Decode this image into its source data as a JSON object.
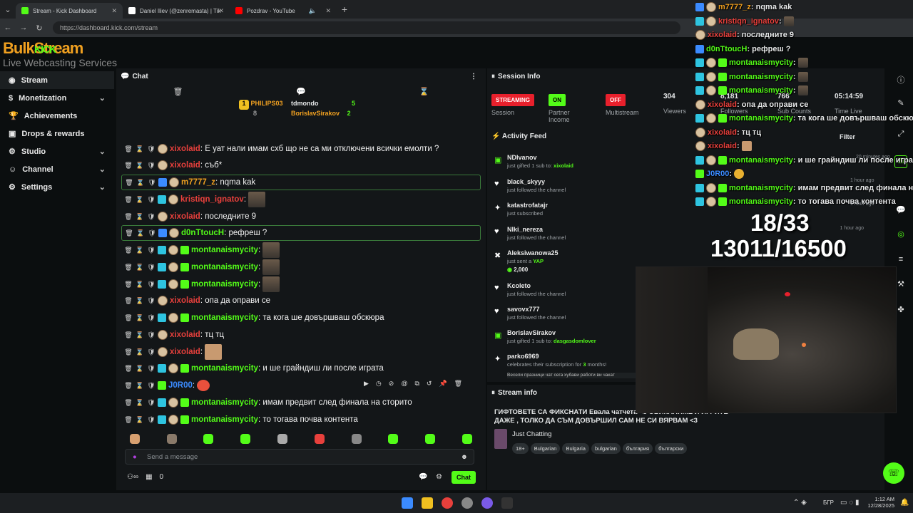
{
  "browser": {
    "tabs": [
      {
        "label": "Stream - Kick Dashboard",
        "color": "#53fc18"
      },
      {
        "label": "Daniel Iliev (@zenremasta) | Tik",
        "color": "#ffffff"
      },
      {
        "label": "Pozdrav - YouTube",
        "color": "#ff0000"
      }
    ],
    "url": "https://dashboard.kick.com/stream"
  },
  "logo": {
    "title": "BulkStream",
    "badge": "KICK",
    "subtitle": "Live Webcasting Services"
  },
  "sidebar": {
    "items": [
      {
        "label": "Stream",
        "icon": "radio-icon"
      },
      {
        "label": "Monetization",
        "icon": "money-icon"
      },
      {
        "label": "Achievements",
        "icon": "trophy-icon"
      },
      {
        "label": "Drops & rewards",
        "icon": "gift-icon"
      },
      {
        "label": "Studio",
        "icon": "gear-icon"
      },
      {
        "label": "Channel",
        "icon": "person-icon"
      },
      {
        "label": "Settings",
        "icon": "gear-icon"
      }
    ]
  },
  "chat": {
    "title": "Chat",
    "leaders": {
      "first": {
        "name": "PHILIPS03",
        "count": "8"
      },
      "second": {
        "name": "tdmondo",
        "count": "5"
      },
      "third": {
        "name": "BorislavSirakov",
        "count": "2"
      }
    },
    "messages": [
      {
        "user": "xixolaid",
        "color": "#e8403c",
        "text": ": Е уат нали имам схб що не са ми отключени всички емолти ?"
      },
      {
        "user": "xixolaid",
        "color": "#e8403c",
        "text": ": съб*"
      },
      {
        "user": "m7777_z",
        "color": "#f0a020",
        "text": ": nqma kak"
      },
      {
        "user": "kristiqn_ignatov",
        "color": "#e8403c",
        "text": ":"
      },
      {
        "user": "xixolaid",
        "color": "#e8403c",
        "text": ": последните 9"
      },
      {
        "user": "d0nTtoucH",
        "color": "#53fc18",
        "text": ": рефреш ?"
      },
      {
        "user": "montanaismycity",
        "color": "#53fc18",
        "text": ":"
      },
      {
        "user": "montanaismycity",
        "color": "#53fc18",
        "text": ":"
      },
      {
        "user": "montanaismycity",
        "color": "#53fc18",
        "text": ":"
      },
      {
        "user": "xixolaid",
        "color": "#e8403c",
        "text": ": опа да оправи се"
      },
      {
        "user": "montanaismycity",
        "color": "#53fc18",
        "text": ": та кога ше довършваш обскюра"
      },
      {
        "user": "xixolaid",
        "color": "#e8403c",
        "text": ": тц тц"
      },
      {
        "user": "xixolaid",
        "color": "#e8403c",
        "text": ":"
      },
      {
        "user": "montanaismycity",
        "color": "#53fc18",
        "text": ": и ше грайндиш ли после играта"
      },
      {
        "user": "J0R00",
        "color": "#3b8bff",
        "text": ":"
      },
      {
        "user": "montanaismycity",
        "color": "#53fc18",
        "text": ": имам предвит след финала на сторито"
      },
      {
        "user": "montanaismycity",
        "color": "#53fc18",
        "text": ": то тогава почва контента"
      }
    ],
    "input_placeholder": "Send a message",
    "footer_count": "0",
    "send_label": "Chat"
  },
  "session": {
    "title": "Session Info",
    "stats": [
      {
        "value": "STREAMING",
        "label": "Session",
        "color": "#e8202c"
      },
      {
        "value": "ON",
        "label": "Partner Income",
        "color": "#53fc18"
      },
      {
        "value": "OFF",
        "label": "Multistream",
        "color": "#e8202c"
      },
      {
        "value": "304",
        "label": "Viewers"
      },
      {
        "value": "8,181",
        "label": "Followers"
      },
      {
        "value": "766",
        "label": "Sub Counts"
      },
      {
        "value": "05:14:59",
        "label": "Time Live"
      }
    ]
  },
  "activity": {
    "title": "Activity Feed",
    "filter": "Filter",
    "items": [
      {
        "user": "NDIvanov",
        "pre": "just gifted ",
        "num": "1",
        "mid": " sub to: ",
        "target": "xixolaid",
        "time": "",
        "icon": "gift-icon"
      },
      {
        "user": "black_skyyy",
        "pre": "just followed the channel",
        "num": "",
        "mid": "",
        "target": "",
        "time": "1 hour ago",
        "icon": "heart-icon"
      },
      {
        "user": "katastrofatajr",
        "pre": "just subscribed",
        "num": "",
        "mid": "",
        "target": "",
        "time": "",
        "icon": "star-icon"
      },
      {
        "user": "Nlki_nereza",
        "pre": "just followed the channel",
        "num": "",
        "mid": "",
        "target": "",
        "time": "1 hour ago",
        "icon": "heart-icon"
      },
      {
        "user": "Aleksiwanowa25",
        "pre": "just sent a ",
        "num": "",
        "mid": "",
        "target": "YAP",
        "time": "",
        "icon": "x-icon",
        "extra": "2,000"
      },
      {
        "user": "Kcoleto",
        "pre": "just followed the channel",
        "num": "",
        "mid": "",
        "target": "",
        "time": "",
        "icon": "heart-icon"
      },
      {
        "user": "savovx777",
        "pre": "just followed the channel",
        "num": "",
        "mid": "",
        "target": "",
        "time": "",
        "icon": "heart-icon"
      },
      {
        "user": "BorislavSirakov",
        "pre": "just gifted ",
        "num": "1",
        "mid": " sub to: ",
        "target": "dasgasdomlover",
        "time": "",
        "icon": "gift-icon"
      },
      {
        "user": "parko6969",
        "pre": "celebrates their subscription for ",
        "num": "3",
        "mid": " months!",
        "target": "",
        "time": "",
        "icon": "star-icon"
      }
    ],
    "scroll_preview": "Весели празници чат сега хубави работи ви чакат"
  },
  "stream_info": {
    "title": "Stream info",
    "stream_title": "ГИФТОВЕТЕ СА ФИКСНАТИ Евала чатчета <3 ОБИКАЛЯМЕ И ИГРИТЕ ДАЖЕ , ТОЛКО ДА СЪМ ДОВЪРШИЛ САМ НЕ СИ ВЯРВАМ <3",
    "category": "Just Chatting",
    "tags": [
      "18+",
      "Bulgarian",
      "Bulgaria",
      "bulgarian",
      "българия",
      "български"
    ]
  },
  "overlay": {
    "lines": [
      {
        "user": "m7777_z",
        "color": "#f0a020",
        "text": ": nqma kak"
      },
      {
        "user": "kristiqn_ignatov",
        "color": "#e8403c",
        "text": ":"
      },
      {
        "user": "xixolaid",
        "color": "#e8403c",
        "text": ": последните 9"
      },
      {
        "user": "d0nTtoucH",
        "color": "#53fc18",
        "text": ": рефреш ?"
      },
      {
        "user": "montanaismycity",
        "color": "#53fc18",
        "text": " :"
      },
      {
        "user": "montanaismycity",
        "color": "#53fc18",
        "text": " :"
      },
      {
        "user": "montanaismycity",
        "color": "#53fc18",
        "text": " :"
      },
      {
        "user": "xixolaid",
        "color": "#e8403c",
        "text": ": опа да оправи се"
      },
      {
        "user": "montanaismycity",
        "color": "#53fc18",
        "text": " : та кога ше довършваш обскюра"
      },
      {
        "user": "xixolaid",
        "color": "#e8403c",
        "text": ": тц тц"
      },
      {
        "user": "xixolaid",
        "color": "#e8403c",
        "text": ":"
      },
      {
        "user": "montanaismycity",
        "color": "#53fc18",
        "text": " : и ше грайндиш ли после играта"
      },
      {
        "user": "J0R00",
        "color": "#3b8bff",
        "text": ":"
      },
      {
        "user": "montanaismycity",
        "color": "#53fc18",
        "text": " : имам предвит след финала на стори"
      },
      {
        "user": "montanaismycity",
        "color": "#53fc18",
        "text": " : то тогава почва контента"
      }
    ],
    "goal1": "18/33",
    "goal2": "13011/16500",
    "times": [
      "20 minutes ago",
      "1 hour ago",
      "1 hour ago"
    ]
  },
  "taskbar": {
    "lang": "БГР",
    "time": "1:12 AM",
    "date": "12/28/2025"
  }
}
